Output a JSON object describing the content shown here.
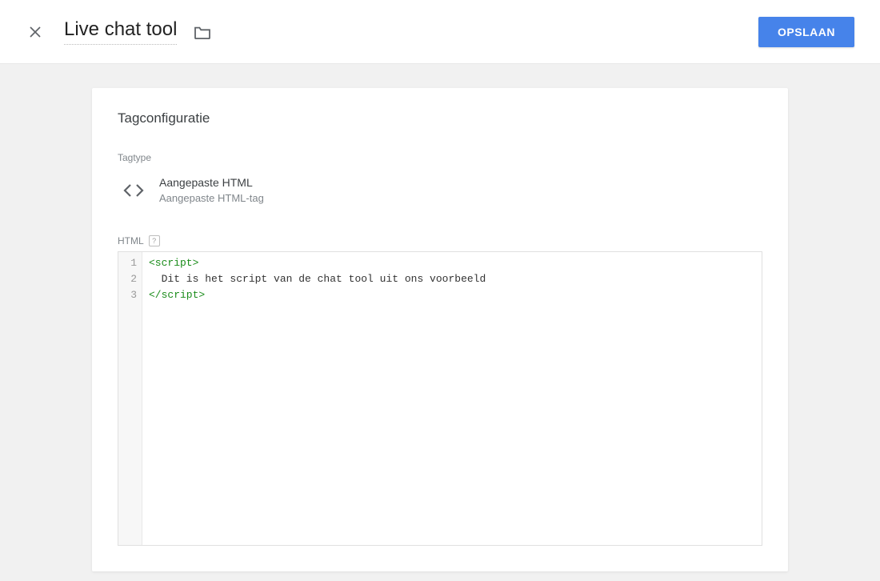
{
  "header": {
    "title": "Live chat tool",
    "save_label": "OPSLAAN"
  },
  "card": {
    "section_title": "Tagconfiguratie",
    "tagtype_label": "Tagtype",
    "tagtype_name": "Aangepaste HTML",
    "tagtype_desc": "Aangepaste HTML-tag",
    "html_label": "HTML",
    "help_symbol": "?"
  },
  "editor": {
    "lines": [
      {
        "num": "1",
        "open": "<script>",
        "text": "",
        "close": ""
      },
      {
        "num": "2",
        "open": "",
        "text": "  Dit is het script van de chat tool uit ons voorbeeld",
        "close": ""
      },
      {
        "num": "3",
        "open": "",
        "text": "",
        "close": "</script>"
      }
    ]
  }
}
